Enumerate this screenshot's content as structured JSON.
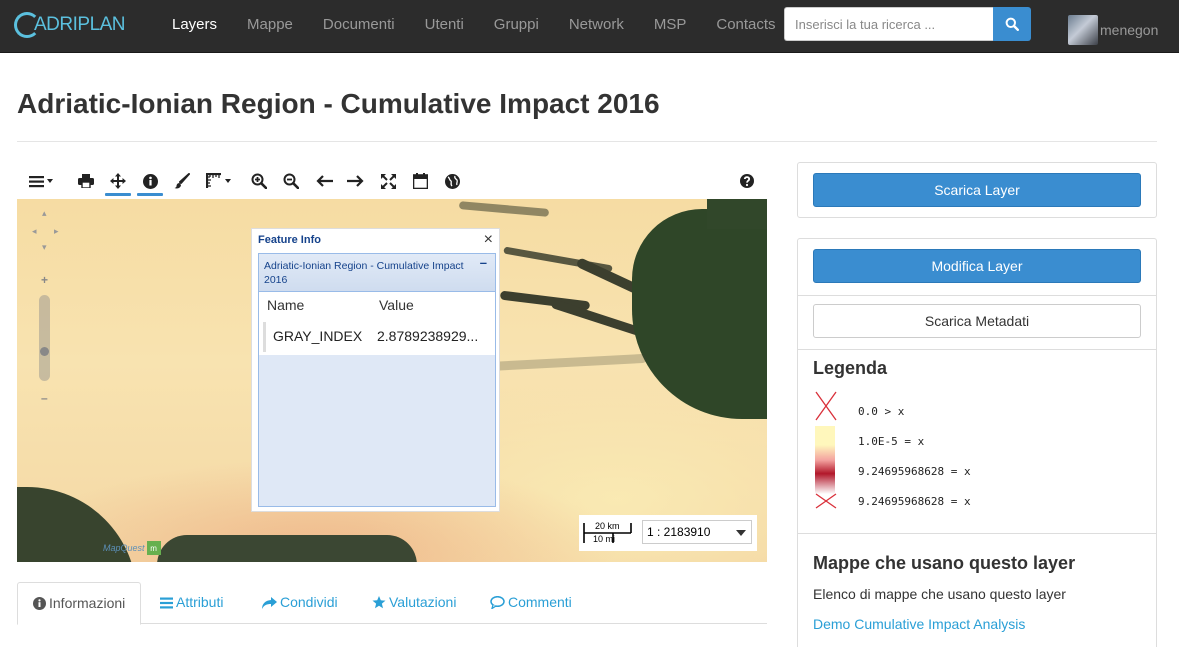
{
  "nav": {
    "brand": "ADRIPLAN",
    "links": [
      "Layers",
      "Mappe",
      "Documenti",
      "Utenti",
      "Gruppi",
      "Network",
      "MSP",
      "Contacts"
    ],
    "active": "Layers",
    "search_placeholder": "Inserisci la tua ricerca ...",
    "username": "menegon"
  },
  "page": {
    "title": "Adriatic-Ionian Region - Cumulative Impact 2016"
  },
  "toolbar": {
    "icons": [
      "menu-icon",
      "print-icon",
      "pan-icon",
      "info-icon",
      "brush-icon",
      "measure-icon",
      "zoom-in-icon",
      "zoom-out-icon",
      "arrow-left-icon",
      "arrow-right-icon",
      "fullscreen-icon",
      "calendar-icon",
      "globe-icon",
      "help-icon"
    ],
    "active_tools": [
      "pan-icon",
      "info-icon"
    ]
  },
  "map": {
    "attribution": "MapQuest",
    "scale_km": "20 km",
    "scale_mi": "10 mi",
    "scale_ratio": "1 : 2183910"
  },
  "feature_info": {
    "title": "Feature Info",
    "layer_title": "Adriatic-Ionian Region - Cumulative Impact 2016",
    "col_name": "Name",
    "col_value": "Value",
    "row_name": "GRAY_INDEX",
    "row_value": "2.8789238929..."
  },
  "tabs": [
    {
      "label": "Informazioni",
      "icon": "info-circle-icon"
    },
    {
      "label": "Attributi",
      "icon": "list-icon"
    },
    {
      "label": "Condividi",
      "icon": "share-icon"
    },
    {
      "label": "Valutazioni",
      "icon": "star-icon"
    },
    {
      "label": "Commenti",
      "icon": "comment-icon"
    }
  ],
  "sidebar": {
    "download_layer": "Scarica Layer",
    "edit_layer": "Modifica Layer",
    "download_metadata": "Scarica Metadati",
    "legend_title": "Legenda",
    "legend": [
      {
        "label": "0.0 > x"
      },
      {
        "label": "1.0E-5 = x"
      },
      {
        "label": "9.24695968628 = x"
      },
      {
        "label": "9.24695968628 = x"
      }
    ],
    "maps_title": "Mappe che usano questo layer",
    "maps_desc": "Elenco di mappe che usano questo layer",
    "maps_link": "Demo Cumulative Impact Analysis"
  },
  "colors": {
    "accent": "#3a8dd0",
    "link": "#2a9fd6",
    "navbar": "#2c2c2c",
    "legend_x": "#d9303a",
    "legend_dark": "#b2182b",
    "legend_light": "#fff7bc"
  }
}
